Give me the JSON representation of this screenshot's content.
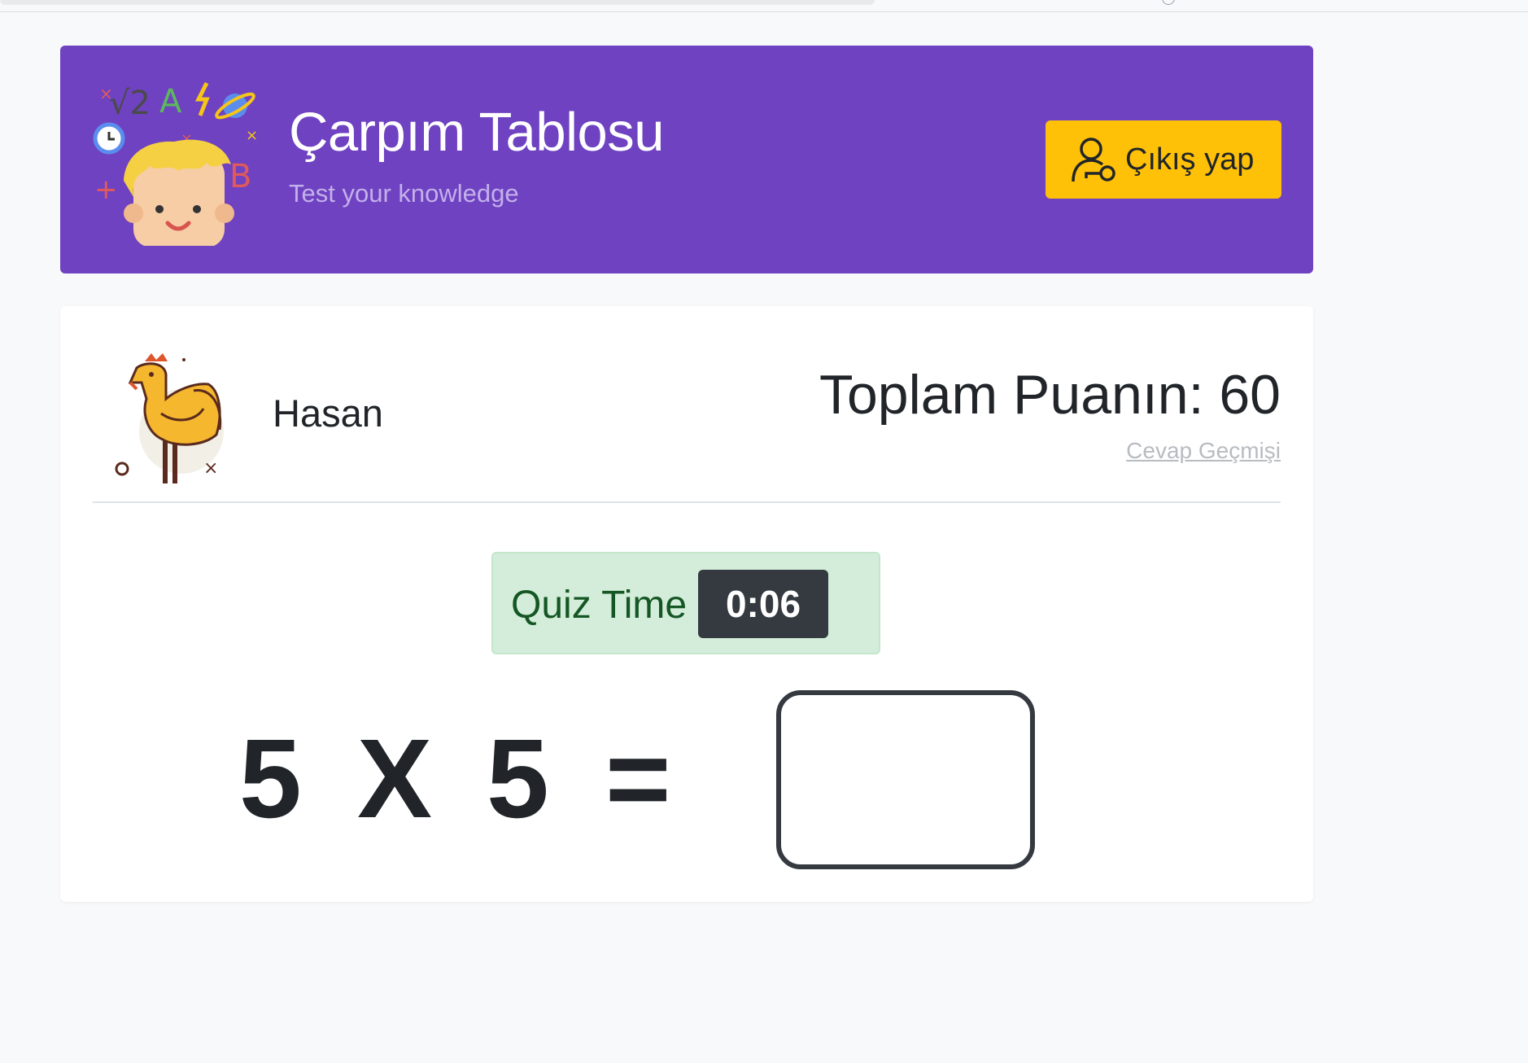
{
  "header": {
    "title": "Çarpım Tablosu",
    "subtitle": "Test your knowledge",
    "logout_label": "Çıkış yap"
  },
  "player": {
    "name": "Hasan",
    "score_text": "Toplam Puanın: 60",
    "history_link": "Cevap Geçmişi"
  },
  "quiz": {
    "timer_label": "Quiz Time",
    "timer_value": "0:06",
    "operand_a": "5",
    "operator": "X",
    "operand_b": "5",
    "equals": "=",
    "answer_value": ""
  },
  "colors": {
    "header_bg": "#6f42c1",
    "logout_bg": "#ffc107",
    "timer_bg": "#d4edda",
    "timer_badge": "#343a40"
  },
  "icons": {
    "logo": "math-kid-logo-icon",
    "logout": "user-key-icon",
    "avatar": "rooster-avatar-icon"
  }
}
